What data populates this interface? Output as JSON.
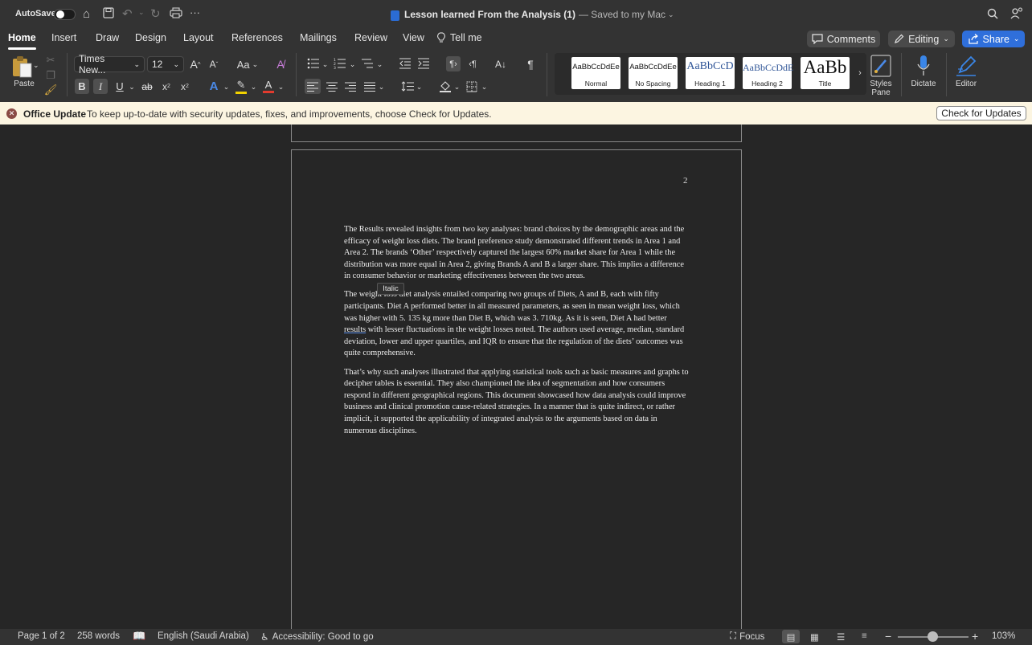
{
  "titlebar": {
    "autosave_label": "AutoSave",
    "autosave_on": false,
    "doc_title": "Lesson learned From the Analysis (1)",
    "save_status": "— Saved to my Mac"
  },
  "tabs": [
    {
      "label": "Home",
      "active": true
    },
    {
      "label": "Insert"
    },
    {
      "label": "Draw"
    },
    {
      "label": "Design"
    },
    {
      "label": "Layout"
    },
    {
      "label": "References"
    },
    {
      "label": "Mailings"
    },
    {
      "label": "Review"
    },
    {
      "label": "View"
    },
    {
      "label": "Tell me"
    }
  ],
  "actions": {
    "comments": "Comments",
    "editing": "Editing",
    "share": "Share"
  },
  "ribbon": {
    "paste_label": "Paste",
    "font_name": "Times New...",
    "font_size": "12",
    "case_label": "Aa",
    "styles": [
      {
        "sample": "AaBbCcDdEe",
        "label": "Normal"
      },
      {
        "sample": "AaBbCcDdEe",
        "label": "No Spacing"
      },
      {
        "sample": "AaBbCcD",
        "label": "Heading 1"
      },
      {
        "sample": "AaBbCcDdE",
        "label": "Heading 2"
      },
      {
        "sample": "AaBb",
        "label": "Title"
      }
    ],
    "styles_pane_label": "Styles Pane",
    "dictate_label": "Dictate",
    "editor_label": "Editor",
    "accent_color": "#2f6fdb",
    "highlight_color": "#f2d200",
    "font_color": "#e23b2e"
  },
  "update_bar": {
    "title": "Office Update",
    "message": "To keep up-to-date with security updates, fixes, and improvements, choose Check for Updates.",
    "button": "Check for Updates"
  },
  "document": {
    "page_number": "2",
    "paragraphs": [
      "The Results revealed insights from two key analyses: brand choices by the demographic areas and the efficacy of weight loss diets. The brand preference study demonstrated different trends in Area 1 and Area 2. The brands ‘Other’ respectively captured the largest 60% market share for Area 1 while the distribution was more equal in Area 2, giving Brands A and B a larger share. This implies a difference in consumer behavior or marketing effectiveness between the two areas.",
      "The weight loss diet analysis entailed comparing two groups of Diets, A and B, each with fifty participants. Diet A performed better in all measured parameters, as seen in mean weight loss, which was higher with 5. 135 kg more than Diet B, which was 3. 710kg. As it is seen, Diet A had better results with lesser fluctuations in the weight losses noted. The authors used average, median, standard deviation, lower and upper quartiles, and IQR to ensure that the regulation of the diets’ outcomes was quite comprehensive.",
      "That’s why such analyses illustrated that applying statistical tools such as basic measures and graphs to decipher tables is essential. They also championed the idea of segmentation and how consumers respond in different geographical regions. This document showcased how data analysis could improve business and clinical promotion cause-related strategies. In a manner that is quite indirect, or rather implicit, it supported the applicability of integrated analysis to the arguments based on data in numerous disciplines."
    ],
    "p2_before": "The weight loss diet analysis entailed comparing two groups of Diets, A and B, each with fifty participants. Diet A performed better in all measured parameters, as seen in mean weight loss, which was higher with 5. 135 kg more than Diet B, which was 3. 710kg. As it is seen, Diet A had better ",
    "p2_flagged": "results",
    "p2_after": " with lesser fluctuations in the weight losses noted. The authors used average, median, standard deviation, lower and upper quartiles, and IQR to ensure that the regulation of the diets’ outcomes was quite comprehensive.",
    "tooltip": "Italic"
  },
  "statusbar": {
    "page": "Page 1 of 2",
    "words": "258 words",
    "language": "English (Saudi Arabia)",
    "accessibility": "Accessibility: Good to go",
    "focus": "Focus",
    "zoom": "103%",
    "zoom_level_fraction": 0.45
  }
}
